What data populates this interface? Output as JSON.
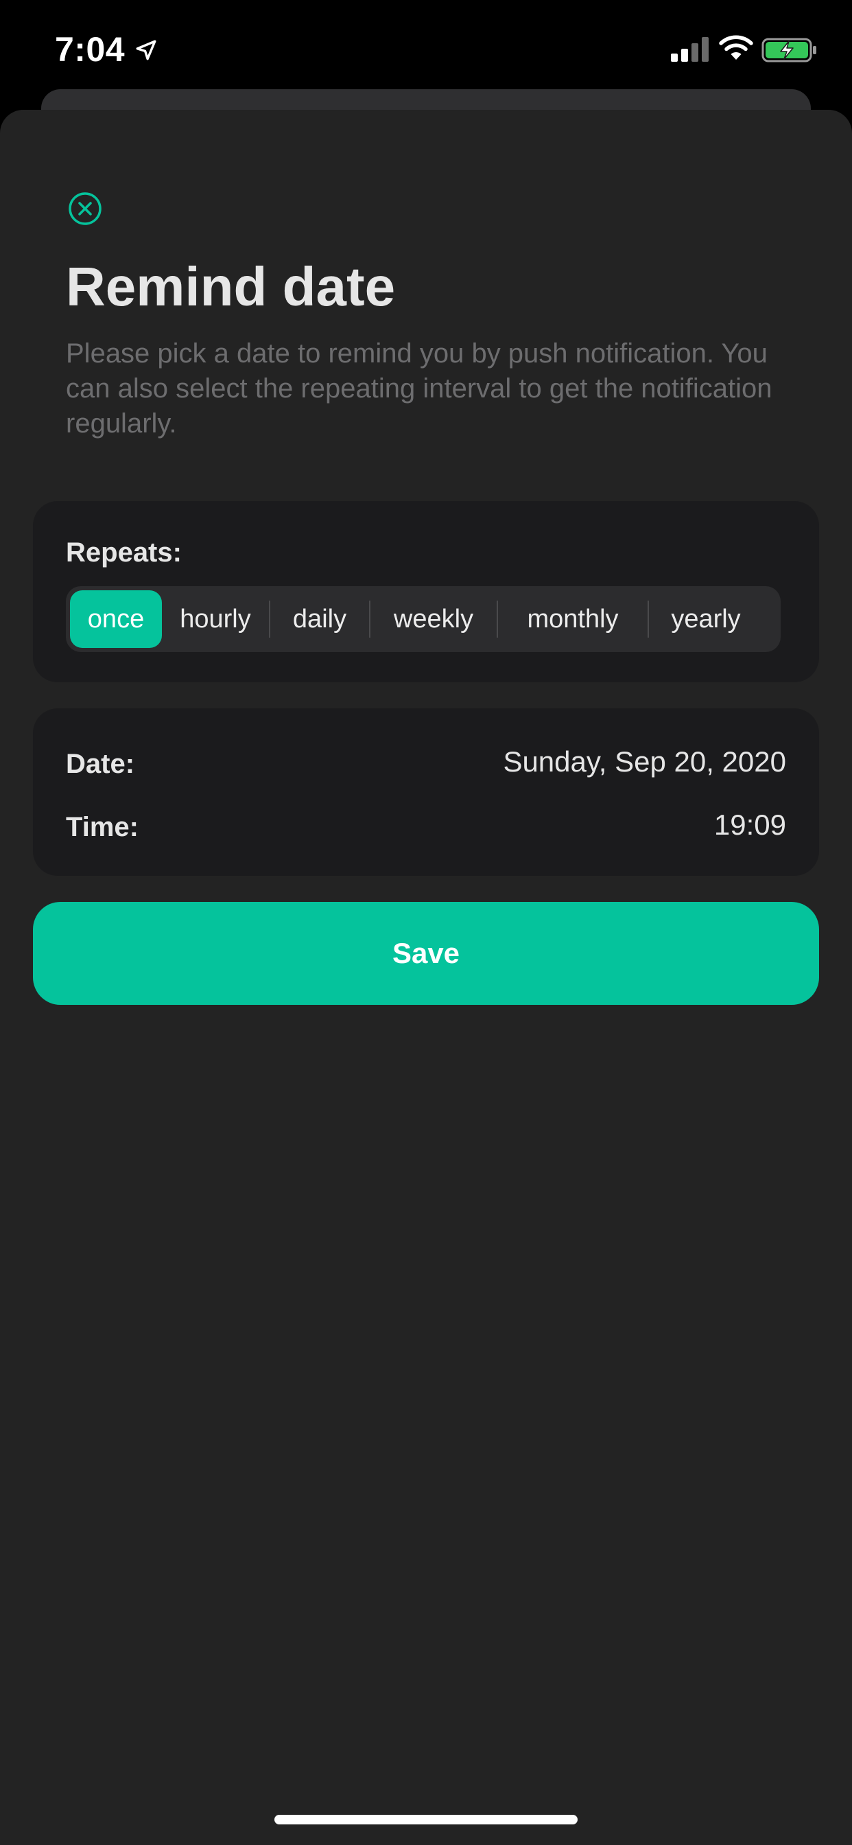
{
  "status_bar": {
    "time": "7:04",
    "icons": [
      "location-arrow-icon",
      "cellular-signal-icon",
      "wifi-icon",
      "battery-charging-icon"
    ]
  },
  "colors": {
    "accent": "#05c39c",
    "sheet_background": "#232323",
    "card_background": "#1b1b1d",
    "title_text": "#e6e6e6",
    "description_text": "#6d6d6f"
  },
  "header": {
    "close_icon": "close-circle-icon",
    "title": "Remind date",
    "description": "Please pick a date to remind you by push notification. You can also select the repeating interval to get the notification regularly."
  },
  "repeats": {
    "label": "Repeats:",
    "options": [
      "once",
      "hourly",
      "daily",
      "weekly",
      "monthly",
      "yearly"
    ],
    "selected": "once"
  },
  "datetime": {
    "date_label": "Date:",
    "date_value": "Sunday, Sep 20, 2020",
    "time_label": "Time:",
    "time_value": "19:09"
  },
  "actions": {
    "save_label": "Save"
  }
}
